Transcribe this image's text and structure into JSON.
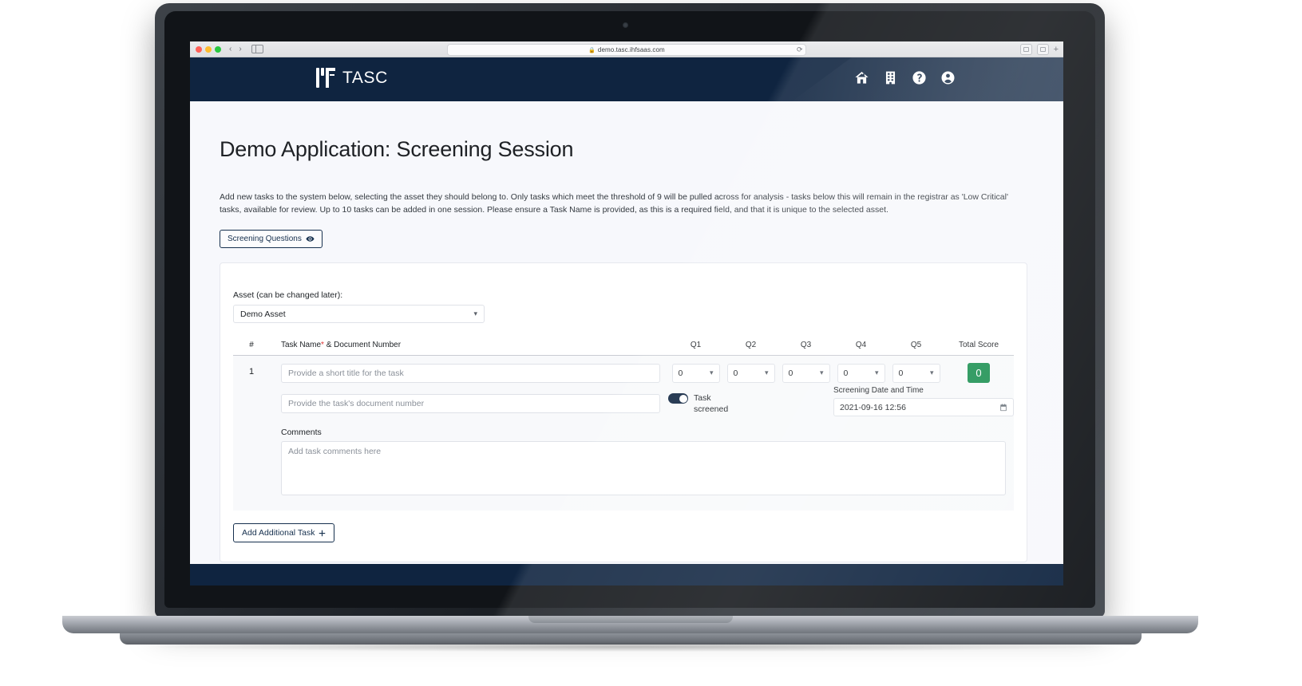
{
  "browser": {
    "url": "demo.tasc.ihfsaas.com",
    "lock_icon": "lock-icon",
    "back_glyph": "‹",
    "forward_glyph": "›",
    "reload_glyph": "⟳",
    "share_glyph": "⇧",
    "tabs_glyph": "⧉",
    "newtab_glyph": "+"
  },
  "header": {
    "brand": "TASC",
    "icons": [
      {
        "name": "home-icon",
        "label": "Home"
      },
      {
        "name": "building-icon",
        "label": "Organisation"
      },
      {
        "name": "help-icon",
        "label": "Help"
      },
      {
        "name": "user-account-icon",
        "label": "Account"
      }
    ],
    "background_color": "#0f2440"
  },
  "page": {
    "title": "Demo Application: Screening Session",
    "description": "Add new tasks to the system below, selecting the asset they should belong to. Only tasks which meet the threshold of 9 will be pulled across for analysis - tasks below this will remain in the registrar as 'Low Critical' tasks, available for review. Up to 10 tasks can be added in one session. Please ensure a Task Name is provided, as this is a required field, and that it is unique to the selected asset.",
    "screening_questions_button": "Screening Questions",
    "screening_questions_icon": "eye-icon"
  },
  "form": {
    "asset_label": "Asset (can be changed later):",
    "asset_value": "Demo Asset",
    "asset_caret_icon": "chevron-down-icon",
    "columns": {
      "hash": "#",
      "task_name": "Task Name",
      "required_marker": "*",
      "task_name_suffix": "& Document Number",
      "questions": [
        "Q1",
        "Q2",
        "Q3",
        "Q4",
        "Q5"
      ],
      "total": "Total Score"
    },
    "rows": [
      {
        "number": "1",
        "task_name_placeholder": "Provide a short title for the task",
        "task_name_value": "",
        "document_number_placeholder": "Provide the task's document number",
        "document_number_value": "",
        "q_values": [
          "0",
          "0",
          "0",
          "0",
          "0"
        ],
        "total_score": "0",
        "total_score_color": "#1f9254",
        "toggle_label": "Task screened",
        "toggle_state": "on",
        "date_label": "Screening Date and Time",
        "date_value": "2021-09-16 12:56",
        "calendar_icon": "calendar-icon",
        "comments_label": "Comments",
        "comments_placeholder": "Add task comments here",
        "comments_value": ""
      }
    ],
    "add_task_button": "Add Additional Task",
    "add_task_icon": "plus-icon"
  }
}
